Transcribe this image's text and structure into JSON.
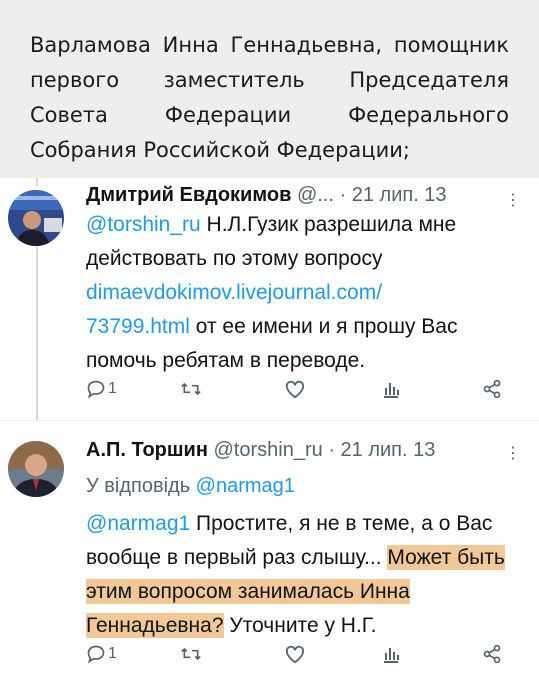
{
  "document_snippet": {
    "text": "Варламова Инна Геннадьевна, помощник первого заместитель Председателя Совета Федерации Федерального Собрания Российской Федерации;"
  },
  "tweets": [
    {
      "author_name": "Дмитрий Евдокимов",
      "handle": "@...",
      "date": "· 21 лип. 13",
      "mention": "@torshin_ru",
      "text_1": " Н.Л.Гузик разрешила мне действовать по этому вопросу ",
      "link_line_1": "dimaevdokimov.livejournal.com/",
      "link_line_2": "73799.html",
      "text_2": " от ее имени и я прошу Вас помочь ребятам в переводе.",
      "reply_count": "1",
      "retweet_count": "",
      "like_count": "",
      "view_count": ""
    },
    {
      "author_name": "А.П. Торшин",
      "handle": "@torshin_ru",
      "date": "· 21 лип. 13",
      "reply_to_label": "У відповідь ",
      "reply_to_handle": "@narmag1",
      "mention": "@narmag1",
      "text_1": " Простите, я не в теме, а о Вас вообще в первый раз слышу... ",
      "highlighted": "Может быть этим вопросом занималась Инна Геннадьевна?",
      "text_2": " Уточните у Н.Г.",
      "reply_count": "1",
      "retweet_count": "",
      "like_count": "",
      "view_count": ""
    }
  ],
  "icons": [
    "reply-icon",
    "retweet-icon",
    "like-icon",
    "views-icon",
    "share-icon",
    "more-icon"
  ],
  "colors": {
    "link": "#1d9bf0",
    "muted": "#536471",
    "highlight": "#f2c896"
  }
}
